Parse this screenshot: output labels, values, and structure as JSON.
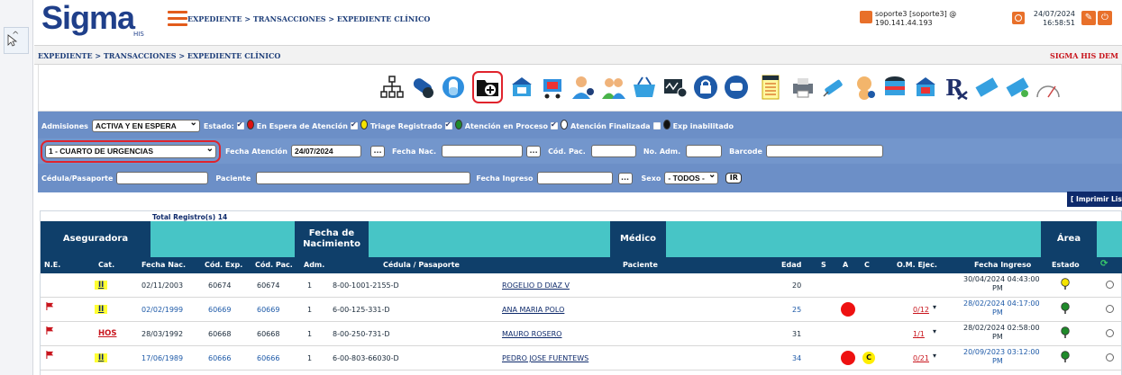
{
  "header": {
    "logo": "Sigma",
    "logo_sub": "HIS",
    "breadcrumb": "EXPEDIENTE > TRANSACCIONES > EXPEDIENTE CLÍNICO",
    "user_line1": "soporte3 [soporte3] @",
    "user_line2": "190.141.44.193",
    "date": "24/07/2024",
    "time": "16:58:51"
  },
  "subheader": {
    "breadcrumb": "EXPEDIENTE > TRANSACCIONES > EXPEDIENTE CLÍNICO",
    "right_text": "SIGMA HIS DEM"
  },
  "toolbar": {
    "icons": [
      "org-chart-icon",
      "pill-icon",
      "capsule-icon",
      "folder-add-icon",
      "basket-icon",
      "cart-icon",
      "doctor-icon",
      "nurse-icon",
      "shopping-basket-icon",
      "monitor-icon",
      "lock-icon",
      "chat-icon",
      "checklist-icon",
      "printer-icon",
      "syringe-icon",
      "baby-icon",
      "pill-bottle-icon",
      "basket-red-icon",
      "rx-icon",
      "tag-icon",
      "tag-icon-2",
      "gauge-icon"
    ],
    "highlighted_index": 3
  },
  "filters": {
    "admisiones_label": "Admisiones",
    "admisiones_value": "ACTIVA Y EN ESPERA",
    "estado_label": "Estado:",
    "status_options": [
      {
        "label": "En Espera de Atención",
        "checked": true,
        "color": "#dd1111"
      },
      {
        "label": "Triage Registrado",
        "checked": true,
        "color": "#f5e400"
      },
      {
        "label": "Atención en Proceso",
        "checked": true,
        "color": "#1f8a2a"
      },
      {
        "label": "Atención Finalizada",
        "checked": true,
        "color": "#ffffff"
      },
      {
        "label": "Exp inabilitado",
        "checked": false,
        "color": "#111111"
      }
    ],
    "area_value": "1 - CUARTO DE URGENCIAS",
    "fecha_atencion_label": "Fecha Atención",
    "fecha_atencion_value": "24/07/2024",
    "fecha_nac_label": "Fecha Nac.",
    "fecha_nac_value": "",
    "cod_pac_label": "Cód. Pac.",
    "cod_pac_value": "",
    "no_adm_label": "No. Adm.",
    "no_adm_value": "",
    "barcode_label": "Barcode",
    "barcode_value": "",
    "cedula_label": "Cédula/Pasaporte",
    "cedula_value": "",
    "paciente_label": "Paciente",
    "paciente_value": "",
    "fecha_ingreso_label": "Fecha Ingreso",
    "fecha_ingreso_value": "",
    "sexo_label": "Sexo",
    "sexo_value": "- TODOS -",
    "ir_label": "IR",
    "dots_label": "..."
  },
  "print_button": "[ Imprimir Lista",
  "table": {
    "total": "Total Registro(s) 14",
    "group_headers": {
      "aseguradora": "Aseguradora",
      "fecha_nacimiento": "Fecha de Nacimiento",
      "medico": "Médico",
      "area": "Área"
    },
    "columns": [
      "N.E.",
      "Cat.",
      "Fecha Nac.",
      "Cód. Exp.",
      "Cód. Pac.",
      "Adm.",
      "Cédula / Pasaporte",
      "Paciente",
      "Edad",
      "S",
      "A",
      "C",
      "O.M. Ejec.",
      "Fecha Ingreso",
      "Estado"
    ],
    "rows": [
      {
        "flag": false,
        "cat": "II",
        "fecha_nac": "02/11/2003",
        "cod_exp": "60674",
        "cod_pac": "60674",
        "adm": "1",
        "cedula": "8-00-1001-2155-D",
        "paciente": "ROGELIO D DIAZ V",
        "edad": "20",
        "s": false,
        "a": false,
        "c": "",
        "om": "",
        "ingreso1": "30/04/2024 04:43:00",
        "ingreso2": "PM",
        "estado_color": "#f5e400",
        "blue": false
      },
      {
        "flag": true,
        "cat": "II",
        "fecha_nac": "02/02/1999",
        "cod_exp": "60669",
        "cod_pac": "60669",
        "adm": "1",
        "cedula": "6-00-125-331-D",
        "paciente": "ANA MARIA POLO",
        "edad": "25",
        "s": true,
        "a": false,
        "c": "",
        "om": "0/12",
        "ingreso1": "28/02/2024 04:17:00",
        "ingreso2": "PM",
        "estado_color": "#1f8a2a",
        "blue": true
      },
      {
        "flag": true,
        "cat": "HOS",
        "fecha_nac": "28/03/1992",
        "cod_exp": "60668",
        "cod_pac": "60668",
        "adm": "1",
        "cedula": "8-00-250-731-D",
        "paciente": "MAURO ROSERO",
        "edad": "31",
        "s": false,
        "a": false,
        "c": "",
        "om": "1/1",
        "ingreso1": "28/02/2024 02:58:00",
        "ingreso2": "PM",
        "estado_color": "#1f8a2a",
        "blue": false
      },
      {
        "flag": true,
        "cat": "II",
        "fecha_nac": "17/06/1989",
        "cod_exp": "60666",
        "cod_pac": "60666",
        "adm": "1",
        "cedula": "6-00-803-66030-D",
        "paciente": "PEDRO JOSE FUENTEWS",
        "edad": "34",
        "s": true,
        "a": true,
        "c": "C",
        "om": "0/21",
        "ingreso1": "20/09/2023 03:12:00",
        "ingreso2": "PM",
        "estado_color": "#1f8a2a",
        "blue": true
      }
    ]
  },
  "colors": {
    "brand": "#1f3f8a",
    "accent": "#e8702a",
    "filter_bg": "#6c8fc7",
    "table_header": "#0f3f6a",
    "group_bg": "#47c5c6"
  }
}
